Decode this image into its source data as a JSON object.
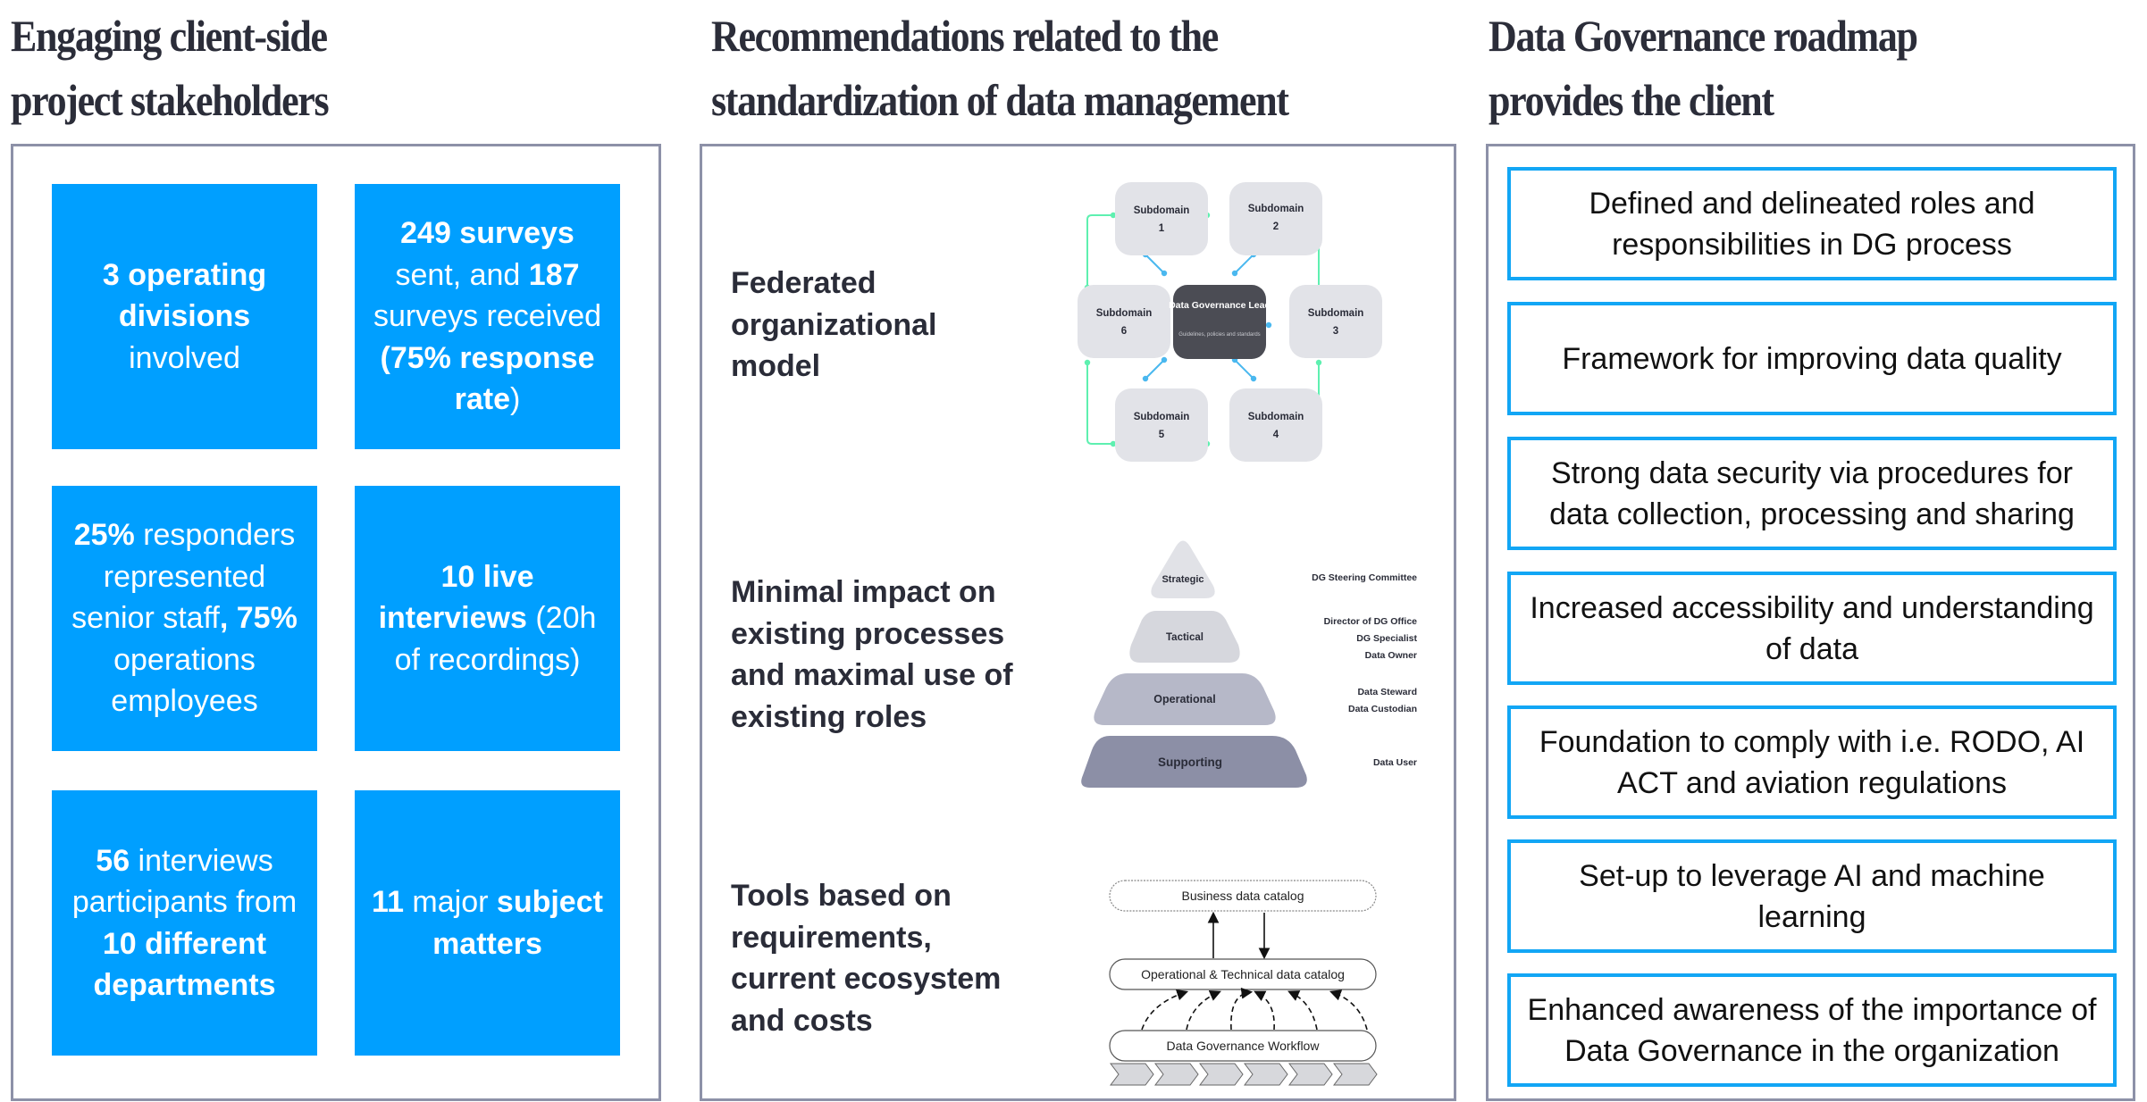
{
  "columns": [
    {
      "title_lines": [
        "Engaging client-side",
        "project stakeholders"
      ],
      "tiles": [
        {
          "parts": [
            {
              "t": "3 operating divisions",
              "b": true
            },
            {
              "t": " involved",
              "b": false
            }
          ]
        },
        {
          "parts": [
            {
              "t": "249 surveys",
              "b": true
            },
            {
              "t": " sent, and ",
              "b": false
            },
            {
              "t": "187",
              "b": true
            },
            {
              "t": " surveys received ",
              "b": false
            },
            {
              "t": "(75% response rate",
              "b": true
            },
            {
              "t": ")",
              "b": false
            }
          ]
        },
        {
          "parts": [
            {
              "t": "25%",
              "b": true
            },
            {
              "t": " responders represented senior staff",
              "b": false
            },
            {
              "t": ", 75%",
              "b": true
            },
            {
              "t": " operations employees",
              "b": false
            }
          ]
        },
        {
          "parts": [
            {
              "t": "10 live interviews",
              "b": true
            },
            {
              "t": " (20h of recordings)",
              "b": false
            }
          ]
        },
        {
          "parts": [
            {
              "t": "56",
              "b": true
            },
            {
              "t": " interviews participants from ",
              "b": false
            },
            {
              "t": "10 different departments",
              "b": true
            }
          ]
        },
        {
          "parts": [
            {
              "t": "11",
              "b": true
            },
            {
              "t": " major ",
              "b": false
            },
            {
              "t": "subject matters",
              "b": true
            }
          ]
        }
      ]
    },
    {
      "title_lines": [
        "Recommendations related to the",
        "standardization of data management"
      ],
      "sections": [
        {
          "label": "Federated organizational model",
          "diagram": {
            "center": {
              "title": "Data Governance Lead",
              "subtitle": "Guidelines, policies and standards"
            },
            "nodes": [
              {
                "label": "Subdomain",
                "num": "1"
              },
              {
                "label": "Subdomain",
                "num": "2"
              },
              {
                "label": "Subdomain",
                "num": "3"
              },
              {
                "label": "Subdomain",
                "num": "4"
              },
              {
                "label": "Subdomain",
                "num": "5"
              },
              {
                "label": "Subdomain",
                "num": "6"
              }
            ]
          }
        },
        {
          "label": "Minimal impact on existing processes and maximal use of existing roles",
          "pyramid": [
            {
              "level": "Strategic",
              "roles": [
                "DG Steering Committee"
              ]
            },
            {
              "level": "Tactical",
              "roles": [
                "Director of DG Office",
                "DG Specialist",
                "Data Owner"
              ]
            },
            {
              "level": "Operational",
              "roles": [
                "Data Steward",
                "Data Custodian"
              ]
            },
            {
              "level": "Supporting",
              "roles": [
                "Data User"
              ]
            }
          ]
        },
        {
          "label": "Tools based on requirements, current ecosystem and costs",
          "tools": {
            "top": "Business data catalog",
            "middle": "Operational & Technical data catalog",
            "bottom": "Data Governance Workflow"
          }
        }
      ]
    },
    {
      "title_lines": [
        "Data Governance roadmap",
        "provides the client"
      ],
      "benefits": [
        "Defined and delineated roles and responsibilities in DG process",
        "Framework for improving data quality",
        "Strong data security via procedures for data collection, processing and sharing",
        "Increased accessibility and understanding of data",
        "Foundation to comply with i.e. RODO, AI ACT and aviation regulations",
        "Set-up to leverage AI and machine learning",
        "Enhanced awareness of the importance of Data Governance in the organization"
      ]
    }
  ],
  "colors": {
    "tile_blue": "#009fff",
    "panel_border": "#8d91a8",
    "benefit_border": "#12a6f5",
    "heading": "#2b2d39",
    "node_gray": "#e2e3e8",
    "center_dark": "#4b4c54",
    "ring_green": "#5ef0b0",
    "spoke_blue": "#4ab8ef",
    "pyramid": [
      "#e1e2e7",
      "#d6d7dd",
      "#b6b8c8",
      "#8c8fa6"
    ]
  }
}
